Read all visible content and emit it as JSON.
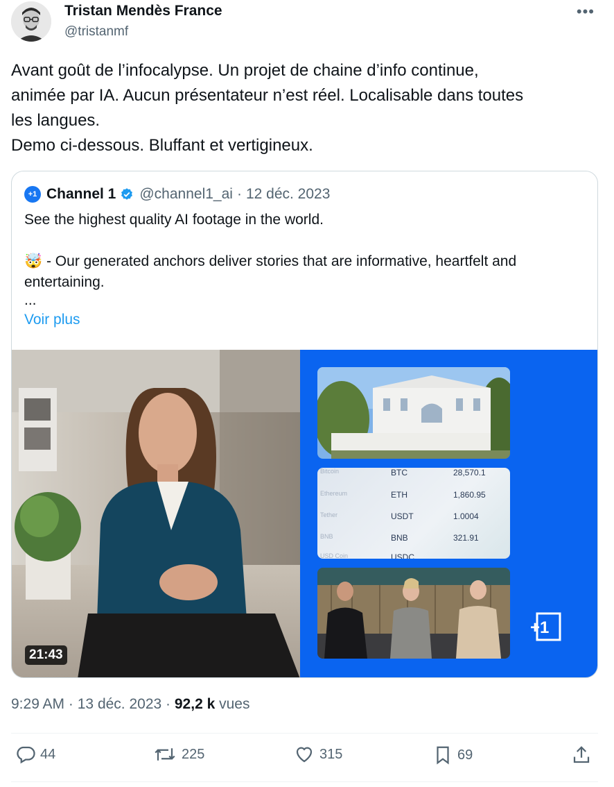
{
  "author": {
    "name": "Tristan Mendès France",
    "handle": "@tristanmf"
  },
  "tweet": {
    "lines": [
      "Avant goût de l’infocalypse. Un projet de chaine d’info continue,",
      "animée par IA. Aucun présentateur n’est réel. Localisable dans toutes",
      "les langues.",
      "Demo ci-dessous. Bluffant et vertigineux."
    ]
  },
  "quote": {
    "logo_text": "+1",
    "name": "Channel 1",
    "handle": "@channel1_ai",
    "separator": "·",
    "date": "12 déc. 2023",
    "text_line1": "See the highest quality AI footage in the world.",
    "text_line2": "🤯 - Our generated anchors deliver stories that are informative, heartfelt and entertaining.",
    "ellipsis": "...",
    "show_more": "Voir plus"
  },
  "video": {
    "duration": "21:43",
    "crypto": [
      {
        "name": "Bitcoin",
        "symbol": "BTC",
        "value": "28,570.1"
      },
      {
        "name": "Ethereum",
        "symbol": "ETH",
        "value": "1,860.95"
      },
      {
        "name": "Tether",
        "symbol": "USDT",
        "value": "1.0004"
      },
      {
        "name": "BNB",
        "symbol": "BNB",
        "value": "321.91"
      },
      {
        "name": "USD Coin",
        "symbol": "USDC",
        "value": ""
      }
    ],
    "overlay_logo": "+1"
  },
  "meta": {
    "time": "9:29 AM",
    "separator": "·",
    "date": "13 déc. 2023",
    "views_count": "92,2 k",
    "views_label": "vues"
  },
  "actions": {
    "replies": "44",
    "reposts": "225",
    "likes": "315",
    "bookmarks": "69"
  },
  "colors": {
    "accent": "#1d9bf0",
    "verified": "#1d9bf0",
    "channel_blue": "#0a64f0",
    "muted": "#536471"
  },
  "icons": [
    "more-icon",
    "verified-icon",
    "reply-icon",
    "repost-icon",
    "like-icon",
    "bookmark-icon",
    "share-icon"
  ]
}
